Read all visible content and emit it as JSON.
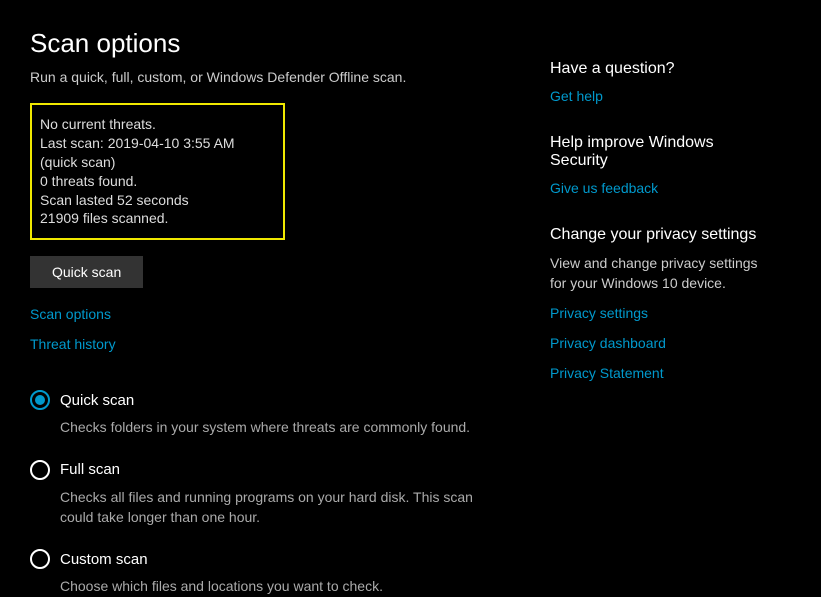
{
  "page": {
    "title": "Scan options",
    "subtitle": "Run a quick, full, custom, or Windows Defender Offline scan."
  },
  "status": {
    "no_threats": "No current threats.",
    "last_scan": "Last scan: 2019-04-10 3:55 AM (quick scan)",
    "threats_found": "0 threats found.",
    "duration": "Scan lasted 52 seconds",
    "files_scanned": "21909 files scanned."
  },
  "buttons": {
    "quick_scan": "Quick scan"
  },
  "links": {
    "scan_options": "Scan options",
    "threat_history": "Threat history"
  },
  "scan_types": [
    {
      "label": "Quick scan",
      "desc": "Checks folders in your system where threats are commonly found.",
      "selected": true
    },
    {
      "label": "Full scan",
      "desc": "Checks all files and running programs on your hard disk. This scan could take longer than one hour.",
      "selected": false
    },
    {
      "label": "Custom scan",
      "desc": "Choose which files and locations you want to check.",
      "selected": false
    }
  ],
  "sidebar": {
    "question": {
      "heading": "Have a question?",
      "link": "Get help"
    },
    "improve": {
      "heading": "Help improve Windows Security",
      "link": "Give us feedback"
    },
    "privacy": {
      "heading": "Change your privacy settings",
      "text": "View and change privacy settings for your Windows 10 device.",
      "links": [
        "Privacy settings",
        "Privacy dashboard",
        "Privacy Statement"
      ]
    }
  }
}
